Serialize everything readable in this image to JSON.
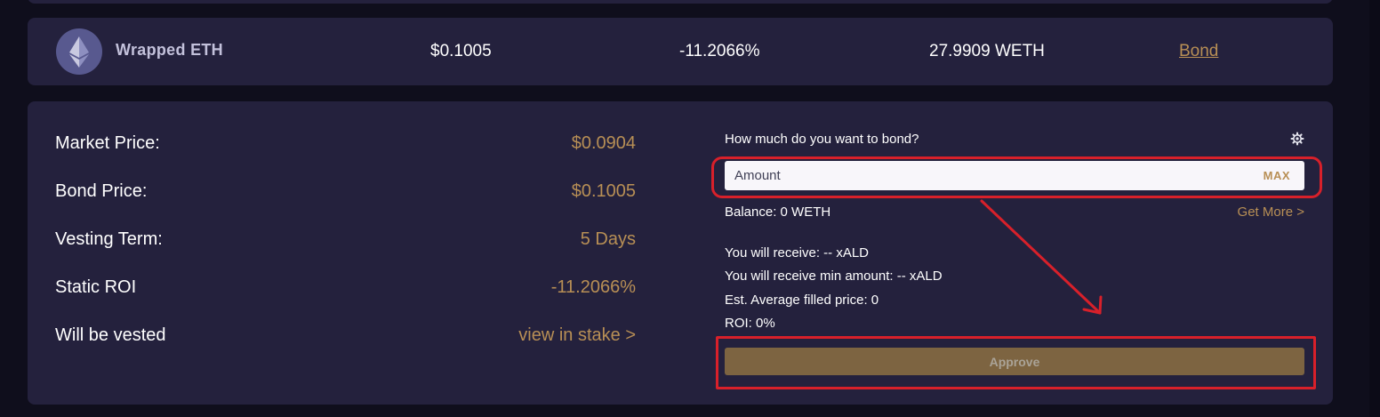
{
  "asset_row": {
    "token_icon": "ethereum-icon",
    "name": "Wrapped ETH",
    "price": "$0.1005",
    "roi": "-11.2066%",
    "purchased": "27.9909 WETH",
    "bond_link": "Bond"
  },
  "details": {
    "stats": [
      {
        "label": "Market Price:",
        "value": "$0.0904"
      },
      {
        "label": "Bond Price:",
        "value": "$0.1005"
      },
      {
        "label": "Vesting Term:",
        "value": "5 Days"
      },
      {
        "label": "Static ROI",
        "value": "-11.2066%"
      },
      {
        "label": "Will be vested",
        "value": "view in stake >"
      }
    ]
  },
  "bond_form": {
    "title": "How much do you want to bond?",
    "settings_icon": "gear-icon",
    "amount_placeholder": "Amount",
    "amount_value": "",
    "max_label": "MAX",
    "balance": "Balance: 0 WETH",
    "get_more": "Get More >",
    "receive": "You will receive: -- xALD",
    "receive_min": "You will receive min amount: -- xALD",
    "avg_price": "Est. Average filled price: 0",
    "roi": "ROI: 0%",
    "approve_label": "Approve"
  },
  "colors": {
    "background": "#0f0e1c",
    "card": "#24213d",
    "accent_gold": "#b88f55",
    "approve_button": "#7d6441",
    "annotation_red": "#d8202a"
  }
}
